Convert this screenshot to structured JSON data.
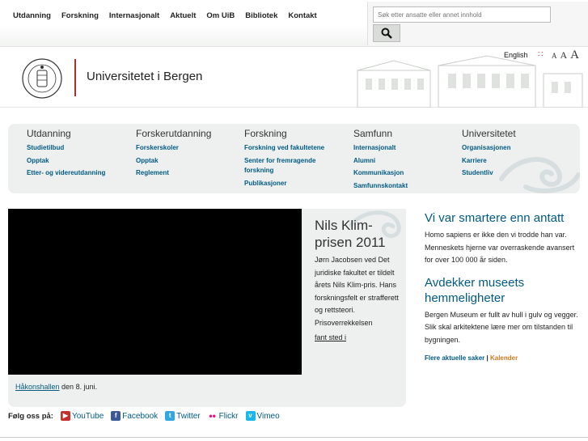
{
  "topnav": {
    "items": [
      "Utdanning",
      "Forskning",
      "Internasjonalt",
      "Aktuelt",
      "Om UiB",
      "Bibliotek",
      "Kontakt"
    ]
  },
  "search": {
    "placeholder": "Søk etter ansatte eller annet innhold",
    "icon": "search-icon"
  },
  "header": {
    "site_title": "Universitetet i Bergen",
    "lang_link": "English",
    "font_sizes": [
      "A",
      "A",
      "A"
    ]
  },
  "megamenu": {
    "columns": [
      {
        "heading": "Utdanning",
        "links": [
          "Studietilbud",
          "Opptak",
          "Etter- og videreutdanning"
        ]
      },
      {
        "heading": "Forskerutdanning",
        "links": [
          "Forskerskoler",
          "Opptak",
          "Reglement"
        ]
      },
      {
        "heading": "Forskning",
        "links": [
          "Forskning ved fakultetene",
          "Senter for fremragende forskning",
          "Publikasjoner"
        ]
      },
      {
        "heading": "Samfunn",
        "links": [
          "Internasjonalt",
          "Alumni",
          "Kommunikasjon",
          "Samfunnskontakt"
        ]
      },
      {
        "heading": "Universitetet",
        "links": [
          "Organisasjonen",
          "Karriere",
          "Studentliv"
        ]
      }
    ]
  },
  "feature": {
    "title": "Nils Klim-prisen 2011",
    "text": "Jørn Jacobsen ved Det juridiske fakultet er tildelt årets Nils Klim-pris. Hans forskningsfelt er strafferett og rettsteori. Prisoverrekkelsen",
    "link": "fant sted i"
  },
  "caption": {
    "link": "Håkonshallen",
    "text": " den 8. juni."
  },
  "news": [
    {
      "title": "Vi var smartere enn antatt",
      "text": "Homo sapiens er ikke den vi trodde han var. Menneskets hjerne var overraskende avansert for over 100 000 år siden."
    },
    {
      "title": "Avdekker museets hemmeligheter",
      "text": "Bergen Museum er fullt av hull i gulv og vegger. Slik skal arkitektene lære mer om tilstanden til bygningen."
    }
  ],
  "more": {
    "news": "Flere aktuelle saker",
    "sep": " | ",
    "calendar": "Kalender"
  },
  "social": {
    "label": "Følg oss på:",
    "links": [
      {
        "name": "YouTube",
        "color": "#c4302b",
        "glyph": "▶"
      },
      {
        "name": "Facebook",
        "color": "#3b5998",
        "glyph": "f"
      },
      {
        "name": "Twitter",
        "color": "#33a8e0",
        "glyph": "t"
      },
      {
        "name": "Flickr",
        "color": "#ff0084",
        "glyph": "•"
      },
      {
        "name": "Vimeo",
        "color": "#1ab7ea",
        "glyph": "v"
      }
    ]
  }
}
